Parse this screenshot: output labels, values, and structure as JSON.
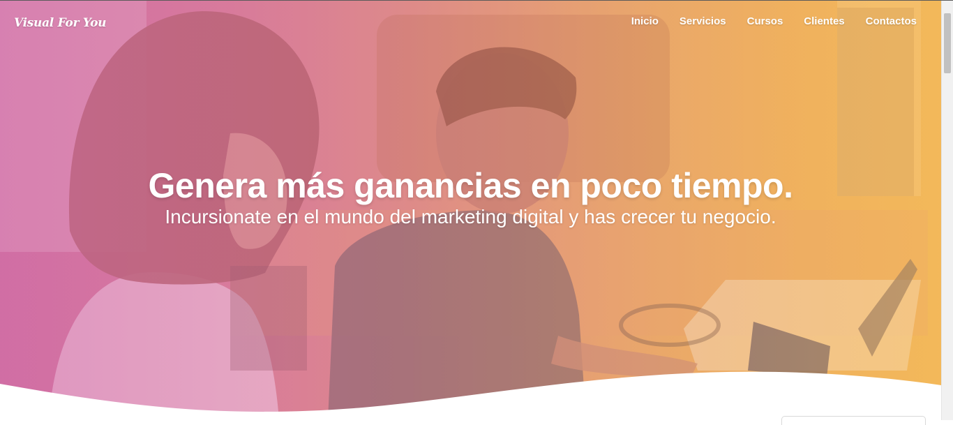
{
  "header": {
    "logo_text": "Visual For You",
    "nav": [
      {
        "label": "Inicio"
      },
      {
        "label": "Servicios"
      },
      {
        "label": "Cursos"
      },
      {
        "label": "Clientes"
      },
      {
        "label": "Contactos"
      }
    ]
  },
  "hero": {
    "title": "Genera más ganancias en poco tiempo.",
    "subtitle": "Incursionate en el mundo del marketing digital y has crecer tu negocio."
  },
  "colors": {
    "gradient_left": "#cf6e9e",
    "gradient_right": "#f2b85a",
    "text": "#ffffff"
  }
}
